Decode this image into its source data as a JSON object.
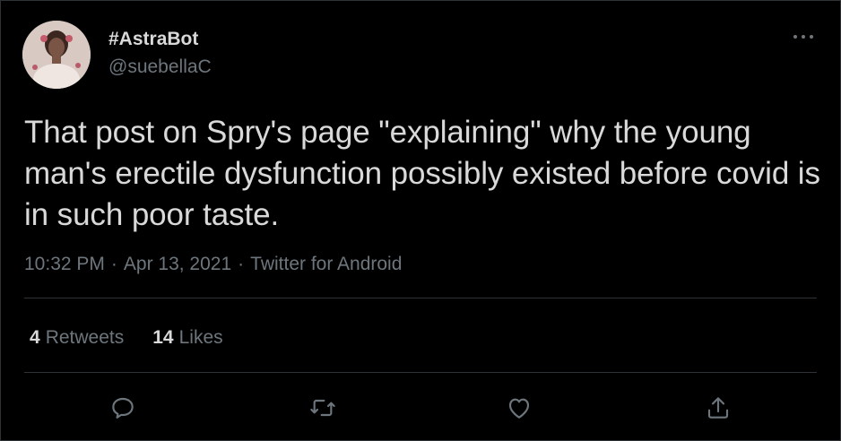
{
  "user": {
    "display_name": "#AstraBot",
    "handle": "@suebellaC",
    "avatar_icon": "profile-photo"
  },
  "tweet": {
    "text": "That post on Spry's page \"explaining\" why the young man's erectile dysfunction possibly existed before covid is in such poor taste.",
    "time": "10:32 PM",
    "separator": "·",
    "date": "Apr 13, 2021",
    "source": "Twitter for Android"
  },
  "stats": {
    "retweets_count": "4",
    "retweets_label": "Retweets",
    "likes_count": "14",
    "likes_label": "Likes"
  },
  "actions": [
    {
      "icon": "reply-icon"
    },
    {
      "icon": "retweet-icon"
    },
    {
      "icon": "like-icon"
    },
    {
      "icon": "share-icon"
    }
  ],
  "menu": {
    "icon": "more-options-icon"
  },
  "colors": {
    "background": "#000000",
    "text_primary": "#d9d9d9",
    "text_secondary": "#6e767d",
    "divider": "#2f3336"
  }
}
